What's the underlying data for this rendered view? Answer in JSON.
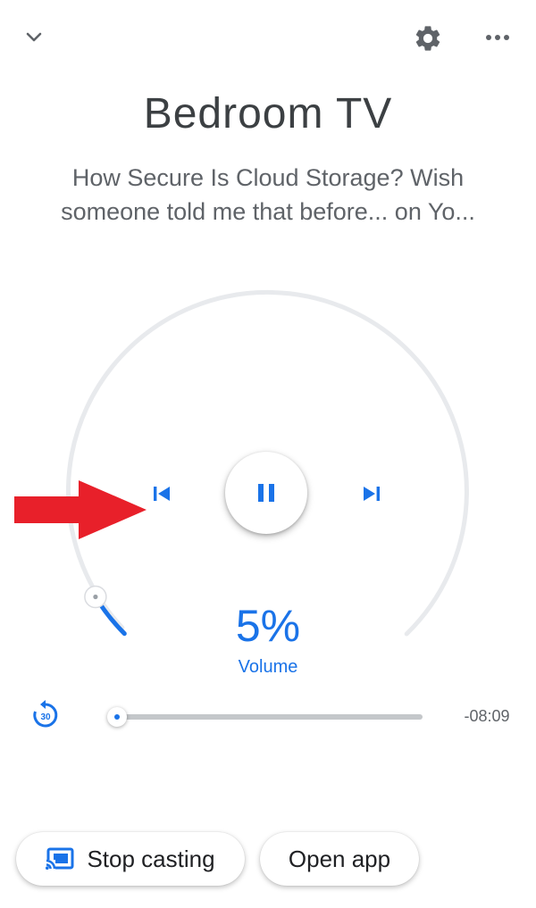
{
  "device": {
    "name": "Bedroom  TV",
    "now_playing": "How Secure Is Cloud Storage? Wish someone told me that before... on Yo..."
  },
  "header": {
    "collapse_icon": "chevron-down-icon",
    "settings_icon": "gear-icon",
    "more_icon": "more-horizontal-icon"
  },
  "controls": {
    "previous_icon": "skip-previous-icon",
    "play_pause_icon": "pause-icon",
    "next_icon": "skip-next-icon"
  },
  "volume": {
    "value": "5%",
    "label": "Volume",
    "level": 0.05
  },
  "playback": {
    "replay_icon": "replay-30-icon",
    "replay_label": "30",
    "remaining": "-08:09",
    "progress": 0.01
  },
  "actions": {
    "stop_casting": "Stop casting",
    "open_app": "Open app"
  },
  "colors": {
    "accent": "#1a73e8",
    "track": "#e8eaed",
    "annotation_arrow": "#e8202a"
  }
}
